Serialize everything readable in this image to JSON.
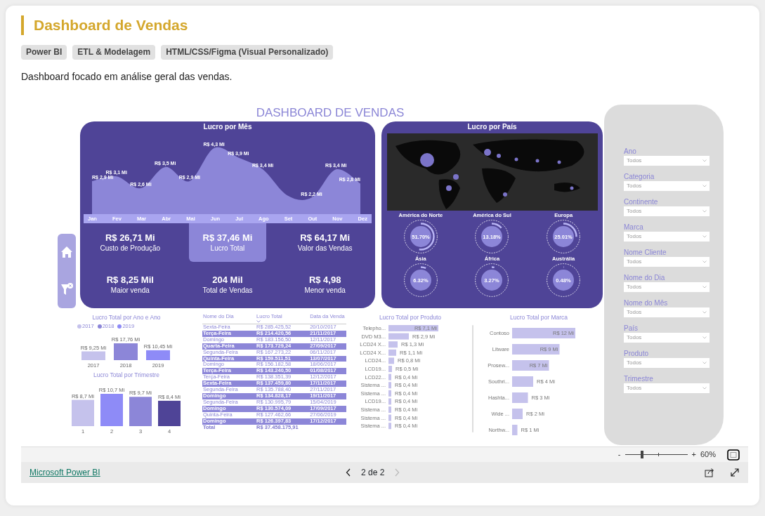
{
  "header": {
    "title": "Dashboard de Vendas",
    "tags": [
      "Power BI",
      "ETL & Modelagem",
      "HTML/CSS/Figma (Visual Personalizado)"
    ],
    "description": "Dashboard focado em análise geral das vendas."
  },
  "report": {
    "title": "DASHBOARD DE VENDAS",
    "monthly": {
      "title": "Lucro por Mês",
      "chart_data": {
        "type": "area",
        "categories": [
          "Jan",
          "Fev",
          "Mar",
          "Abr",
          "Mai",
          "Jun",
          "Jul",
          "Ago",
          "Set",
          "Out",
          "Nov",
          "Dez"
        ],
        "values": [
          2.9,
          3.1,
          2.6,
          3.5,
          2.9,
          4.3,
          3.9,
          3.4,
          2.3,
          2.2,
          3.4,
          2.8
        ],
        "value_labels": [
          "R$ 2,9 Mi",
          "R$ 3,1 Mi",
          "R$ 2,6 Mi",
          "R$ 3,5 Mi",
          "R$ 2,9 Mi",
          "R$ 4,3 Mi",
          "R$ 3,9 Mi",
          "R$ 3,4 Mi",
          null,
          "R$ 2,2 Mi",
          "R$ 3,4 Mi",
          "R$ 2,8 Mi"
        ]
      }
    },
    "kpis": [
      {
        "value": "R$ 26,71 Mi",
        "label": "Custo de Produção",
        "highlighted": false
      },
      {
        "value": "R$ 37,46 Mi",
        "label": "Lucro Total",
        "highlighted": true
      },
      {
        "value": "R$ 64,17 Mi",
        "label": "Valor das Vendas",
        "highlighted": false
      },
      {
        "value": "R$ 8,25 Mil",
        "label": "Maior venda",
        "highlighted": false
      },
      {
        "value": "204 Mil",
        "label": "Total de Vendas",
        "highlighted": false
      },
      {
        "value": "R$ 4,98",
        "label": "Menor venda",
        "highlighted": false
      }
    ],
    "country": {
      "title": "Lucro por País",
      "regions": [
        {
          "label": "América do Norte",
          "reading": "51.70%",
          "level": 0.517
        },
        {
          "label": "América do Sul",
          "reading": "13.18%",
          "level": 0.1318
        },
        {
          "label": "Europa",
          "reading": "25.01%",
          "level": 0.2501
        },
        {
          "label": "Ásia",
          "reading": "6.32%",
          "level": 0.0632
        },
        {
          "label": "África",
          "reading": "3.27%",
          "level": 0.0327
        },
        {
          "label": "Austrália",
          "reading": "0.48%",
          "level": 0.0048
        }
      ]
    },
    "year_chart": {
      "title": "Lucro Total por Ano e Ano",
      "chart_data": {
        "type": "bar",
        "categories": [
          "2017",
          "2018",
          "2019"
        ],
        "values": [
          9.25,
          17.76,
          10.45
        ],
        "colors": [
          "#c5c2ec",
          "#8c86d8",
          "#8e8bf7"
        ],
        "value_labels": [
          "R$ 9,25 Mi",
          "R$ 17,76 Mi",
          "R$ 10,45 Mi"
        ]
      }
    },
    "quarter_chart": {
      "title": "Lucro Total por Trimestre",
      "chart_data": {
        "type": "bar",
        "categories": [
          "1",
          "2",
          "3",
          "4"
        ],
        "values": [
          8.7,
          10.7,
          9.7,
          8.4
        ],
        "colors": [
          "#c5c2ec",
          "#8e8bf7",
          "#8c86d8",
          "#4f4497"
        ],
        "value_labels": [
          "R$ 8,7 Mi",
          "R$ 10,7 Mi",
          "R$ 9,7 Mi",
          "R$ 8,4 Mi"
        ]
      }
    },
    "table": {
      "columns": [
        {
          "label": "Nome do Dia",
          "sorted": false
        },
        {
          "label": "Lucro Total",
          "sorted": true
        },
        {
          "label": "Data da Venda",
          "sorted": false
        }
      ],
      "rows": [
        [
          "Sexta-Feira",
          "R$ 285.425,52",
          "20/10/2017"
        ],
        [
          "Terça-Feira",
          "R$ 214.420,56",
          "21/11/2017"
        ],
        [
          "Domingo",
          "R$ 183.156,50",
          "12/11/2017"
        ],
        [
          "Quarta-Feira",
          "R$ 173.729,24",
          "27/09/2017"
        ],
        [
          "Segunda-Feira",
          "R$ 167.273,22",
          "06/11/2017"
        ],
        [
          "Quinta-Feira",
          "R$ 159.511,51",
          "13/07/2017"
        ],
        [
          "Domingo",
          "R$ 156.182,58",
          "18/06/2017"
        ],
        [
          "Terça-Feira",
          "R$ 143.240,50",
          "01/08/2017"
        ],
        [
          "Terça-Feira",
          "R$ 138.351,39",
          "12/12/2017"
        ],
        [
          "Sexta-Feira",
          "R$ 137.459,80",
          "17/11/2017"
        ],
        [
          "Segunda-Feira",
          "R$ 135.788,40",
          "27/11/2017"
        ],
        [
          "Domingo",
          "R$ 134.828,17",
          "19/11/2017"
        ],
        [
          "Segunda-Feira",
          "R$ 130.995,79",
          "15/04/2019"
        ],
        [
          "Domingo",
          "R$ 130.574,09",
          "17/09/2017"
        ],
        [
          "Quinta-Feira",
          "R$ 127.462,66",
          "27/06/2019"
        ],
        [
          "Domingo",
          "R$ 126.397,83",
          "17/12/2017"
        ]
      ],
      "total": [
        "Total",
        "R$ 37.458.175,91"
      ]
    },
    "product_chart": {
      "title": "Lucro Total por Produto",
      "chart_data": {
        "type": "bar",
        "orientation": "horizontal",
        "categories": [
          "Telepho...",
          "DVD M3...",
          "LCD24 X...",
          "LCD24 X...",
          "LCD24...",
          "LCD19...",
          "LCD22...",
          "Sistema ...",
          "Sistema ...",
          "LCD19...",
          "Sistema ...",
          "Sistema ...",
          "Sistema ..."
        ],
        "values": [
          7.1,
          2.9,
          1.3,
          1.1,
          0.8,
          0.5,
          0.4,
          0.4,
          0.4,
          0.4,
          0.4,
          0.4,
          0.4
        ],
        "value_labels": [
          "R$ 7,1 Mi",
          "R$ 2,9 Mi",
          "R$ 1,3 Mi",
          "R$ 1,1 Mi",
          "R$ 0,8 Mi",
          "R$ 0,5 Mi",
          "R$ 0,4 Mi",
          "R$ 0,4 Mi",
          "R$ 0,4 Mi",
          "R$ 0,4 Mi",
          "R$ 0,4 Mi",
          "R$ 0,4 Mi",
          "R$ 0,4 Mi"
        ]
      }
    },
    "brand_chart": {
      "title": "Lucro Total por Marca",
      "chart_data": {
        "type": "bar",
        "orientation": "horizontal",
        "categories": [
          "Contoso",
          "Litware",
          "Prosew...",
          "Southri...",
          "Hashta...",
          "Wide ...",
          "Northw..."
        ],
        "values": [
          12,
          9,
          7,
          4,
          3,
          2,
          1
        ],
        "value_labels": [
          "R$ 12 Mi",
          "R$ 9 Mi",
          "R$ 7 Mi",
          "R$ 4 Mi",
          "R$ 3 Mi",
          "R$ 2 Mi",
          "R$ 1 Mi"
        ]
      }
    },
    "slicers": [
      {
        "label": "Ano",
        "value": "Todos"
      },
      {
        "label": "Categoria",
        "value": "Todos"
      },
      {
        "label": "Continente",
        "value": "Todos"
      },
      {
        "label": "Marca",
        "value": "Todos"
      },
      {
        "label": "Nome Cliente",
        "value": "Todos"
      },
      {
        "label": "Nome do Dia",
        "value": "Todos"
      },
      {
        "label": "Nome do Mês",
        "value": "Todos"
      },
      {
        "label": "País",
        "value": "Todos"
      },
      {
        "label": "Produto",
        "value": "Todos"
      },
      {
        "label": "Trimestre",
        "value": "Todos"
      }
    ]
  },
  "zoom": {
    "minus": "-",
    "plus": "+",
    "reading": "60%",
    "level": 0.27
  },
  "footer": {
    "link": "Microsoft Power BI",
    "page": "2 de 2",
    "prev_disabled": false,
    "next_disabled": true
  }
}
